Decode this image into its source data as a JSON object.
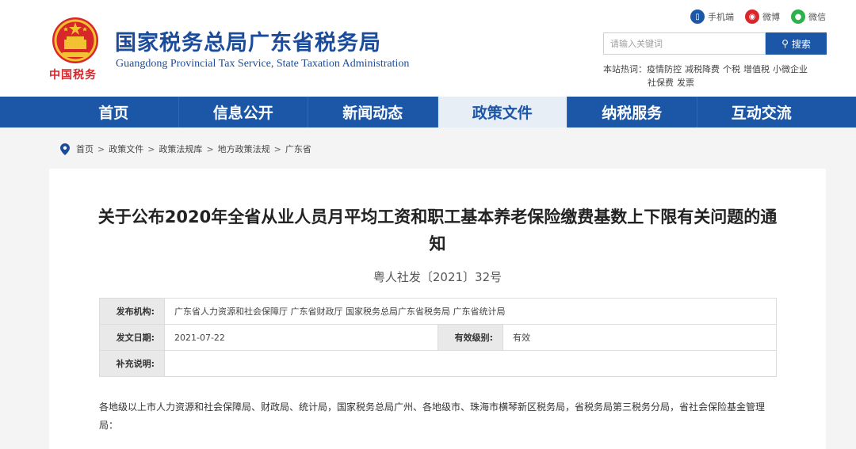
{
  "header": {
    "brand_script": "中国税务",
    "title": "国家税务总局广东省税务局",
    "subtitle": "Guangdong Provincial Tax Service, State Taxation Administration",
    "top_links": [
      {
        "label": "手机端",
        "icon": "mobile-icon",
        "color": "#1b56a7"
      },
      {
        "label": "微博",
        "icon": "weibo-icon",
        "color": "#d9262b"
      },
      {
        "label": "微信",
        "icon": "wechat-icon",
        "color": "#2bb24c"
      }
    ],
    "search": {
      "placeholder": "请输入关键词",
      "button_label": "搜索"
    },
    "hot": {
      "label": "本站热词：",
      "words": [
        "疫情防控",
        "减税降费",
        "个税",
        "增值税",
        "小微企业",
        "社保费",
        "发票"
      ]
    }
  },
  "nav": {
    "items": [
      "首页",
      "信息公开",
      "新闻动态",
      "政策文件",
      "纳税服务",
      "互动交流"
    ],
    "active_index": 3
  },
  "breadcrumb": [
    "首页",
    "政策文件",
    "政策法规库",
    "地方政策法规",
    "广东省"
  ],
  "document": {
    "title": "关于公布2020年全省从业人员月平均工资和职工基本养老保险缴费基数上下限有关问题的通知",
    "number": "粤人社发〔2021〕32号",
    "meta": {
      "issuer_label": "发布机构:",
      "issuer_value": "广东省人力资源和社会保障厅 广东省财政厅 国家税务总局广东省税务局 广东省统计局",
      "date_label": "发文日期:",
      "date_value": "2021-07-22",
      "validity_label": "有效级别:",
      "validity_value": "有效",
      "note_label": "补充说明:",
      "note_value": ""
    },
    "body": "各地级以上市人力资源和社会保障局、财政局、统计局，国家税务总局广州、各地级市、珠海市横琴新区税务局，省税务局第三税务分局，省社会保险基金管理局："
  },
  "colors": {
    "brand_blue": "#1b56a7",
    "brand_red": "#d9262b"
  }
}
